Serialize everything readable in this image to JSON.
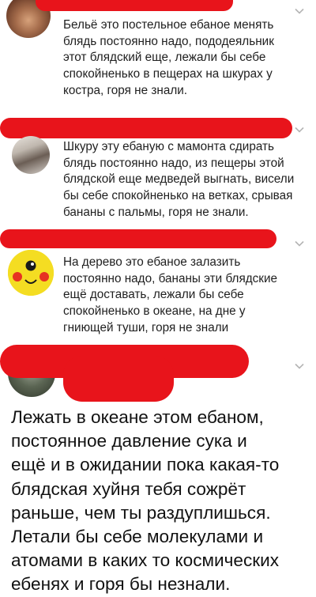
{
  "comments": [
    {
      "avatar": "photo-avatar",
      "text": "Бельё это постельное ебаное менять\nблядь постоянно надо, пододеяльник\nэтот блядский еще, лежали бы себе\nспокойненько в пещерах на шкурах у\nкостра, горя не знали."
    },
    {
      "avatar": "photo-avatar",
      "text": "Шкуру эту ебаную с мамонта сдирать\nблядь постоянно надо, из пещеры этой\nблядской еще медведей выгнать, висели\nбы себе спокойненько на ветках, срывая\nбананы с пальмы, горя не знали."
    },
    {
      "avatar": "pikachu-avatar",
      "text": "На дерево это ебаное залазить\nпостоянно надо, бананы эти блядские\nещё доставать, лежали бы себе\nспокойненько в океане, на дне у\nгниющей туши, горя не знали"
    },
    {
      "avatar": "photo-avatar",
      "text": "Лежать в океане этом ебаном,\nпостоянное давление сука и\nещё и в ожидании пока какая-то\nблядская хуйня тебя сожрёт\nраньше, чем ты раздуплишься.\nЛетали бы себе молекулами и\nатомами в каких то космических\nебенях и горя бы незнали."
    }
  ],
  "colors": {
    "redaction": "#e8141b",
    "chevron": "#b4b4b4",
    "text": "#1f1f1f"
  },
  "icons": {
    "menu": "chevron-down-icon"
  }
}
